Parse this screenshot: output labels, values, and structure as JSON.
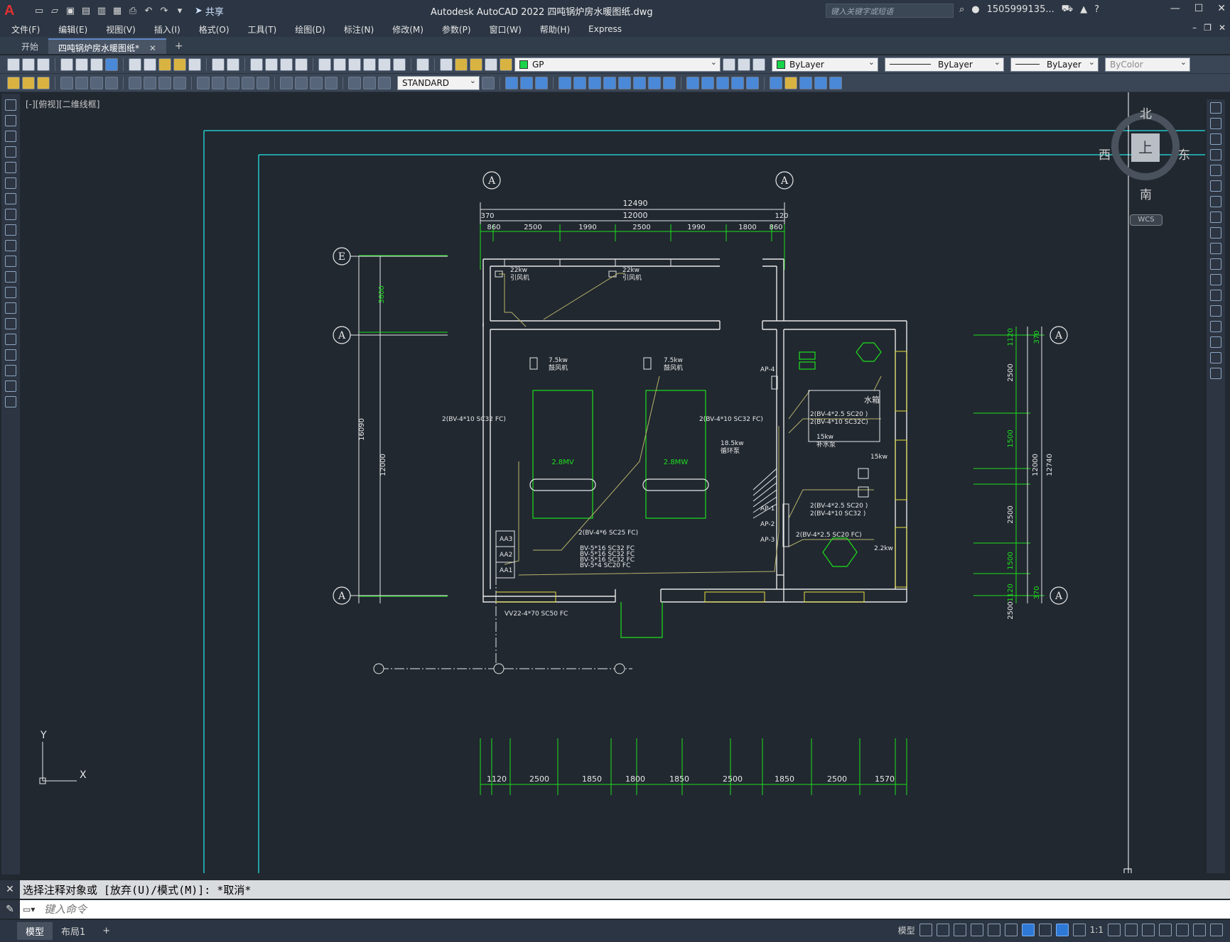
{
  "app": {
    "logo": "A",
    "title": "Autodesk AutoCAD 2022    四吨锅炉房水暖图纸.dwg",
    "share": "共享",
    "search_placeholder": "键入关键字或短语",
    "user": "1505999135...",
    "window_controls": [
      "—",
      "☐",
      "✕"
    ]
  },
  "menu": {
    "items": [
      "文件(F)",
      "编辑(E)",
      "视图(V)",
      "插入(I)",
      "格式(O)",
      "工具(T)",
      "绘图(D)",
      "标注(N)",
      "修改(M)",
      "参数(P)",
      "窗口(W)",
      "帮助(H)",
      "Express"
    ]
  },
  "tabs": {
    "start": "开始",
    "drawing": "四吨锅炉房水暖图纸*",
    "close": "✕",
    "add": "+"
  },
  "properties": {
    "layer": "GP",
    "color": "ByLayer",
    "linetype": "ByLayer",
    "lineweight": "ByLayer",
    "plotstyle": "ByColor",
    "textstyle": "STANDARD"
  },
  "viewport_label": "[-][俯视][二维线框]",
  "viewcube": {
    "north": "北",
    "south": "南",
    "east": "东",
    "west": "西",
    "top": "上",
    "wcs": "WCS"
  },
  "drawing": {
    "dims_top": {
      "total": "12490",
      "inner": "12000",
      "left": "370",
      "right": "120",
      "segments": [
        "860",
        "2500",
        "1990",
        "2500",
        "1990",
        "1800",
        "860"
      ]
    },
    "dims_bottom": [
      "1120",
      "2500",
      "1850",
      "1800",
      "1850",
      "2500",
      "1850",
      "2500",
      "1570"
    ],
    "dims_left": [
      "3600",
      "16090",
      "12000"
    ],
    "dims_right": [
      "1120",
      "2500",
      "1500",
      "2500",
      "1500",
      "2500",
      "1120",
      "12000",
      "12740",
      "370",
      "370"
    ],
    "axis_labels": [
      "A",
      "A",
      "E",
      "A",
      "A",
      "A",
      "A"
    ],
    "equipment": [
      {
        "power": "22kw",
        "name": "引风机"
      },
      {
        "power": "22kw",
        "name": "引风机"
      },
      {
        "power": "7.5kw",
        "name": "鼓风机"
      },
      {
        "power": "7.5kw",
        "name": "鼓风机"
      },
      {
        "power": "18.5kw",
        "name": "循环泵"
      },
      {
        "power": "15kw",
        "name": "补水泵"
      },
      {
        "power": "15kw",
        "name": ""
      },
      {
        "power": "2.2kw",
        "name": ""
      }
    ],
    "boilers": [
      "2.8MV",
      "2.8MW"
    ],
    "water_tank": "水箱",
    "panels": [
      "AA3",
      "AA2",
      "AA1"
    ],
    "ap_labels": [
      "AP-4",
      "AP-1",
      "AP-2",
      "AP-3"
    ],
    "cables": [
      "2(BV-4*10 SC32 FC)",
      "2(BV-4*10 SC32 FC)",
      "2(BV-4*2.5 SC20 )",
      "2(BV-4*10 SC32C)",
      "2(BV-4*2.5 SC20 )",
      "2(BV-4*10 SC32 )",
      "2(BV-4*2.5 SC20 FC)",
      "2(BV-4*6 SC25 FC)",
      "BV-5*16 SC32 FC",
      "BV-5*16 SC32 FC",
      "BV-5*16 SC32 FC",
      "BV-5*4 SC20 FC",
      "VV22-4*70 SC50 FC"
    ]
  },
  "command": {
    "history": "选择注释对象或 [放弃(U)/模式(M)]: *取消*",
    "placeholder": "键入命令"
  },
  "status": {
    "layouts": [
      "模型",
      "布局1"
    ],
    "add": "+",
    "model": "模型",
    "scale": "1:1"
  }
}
